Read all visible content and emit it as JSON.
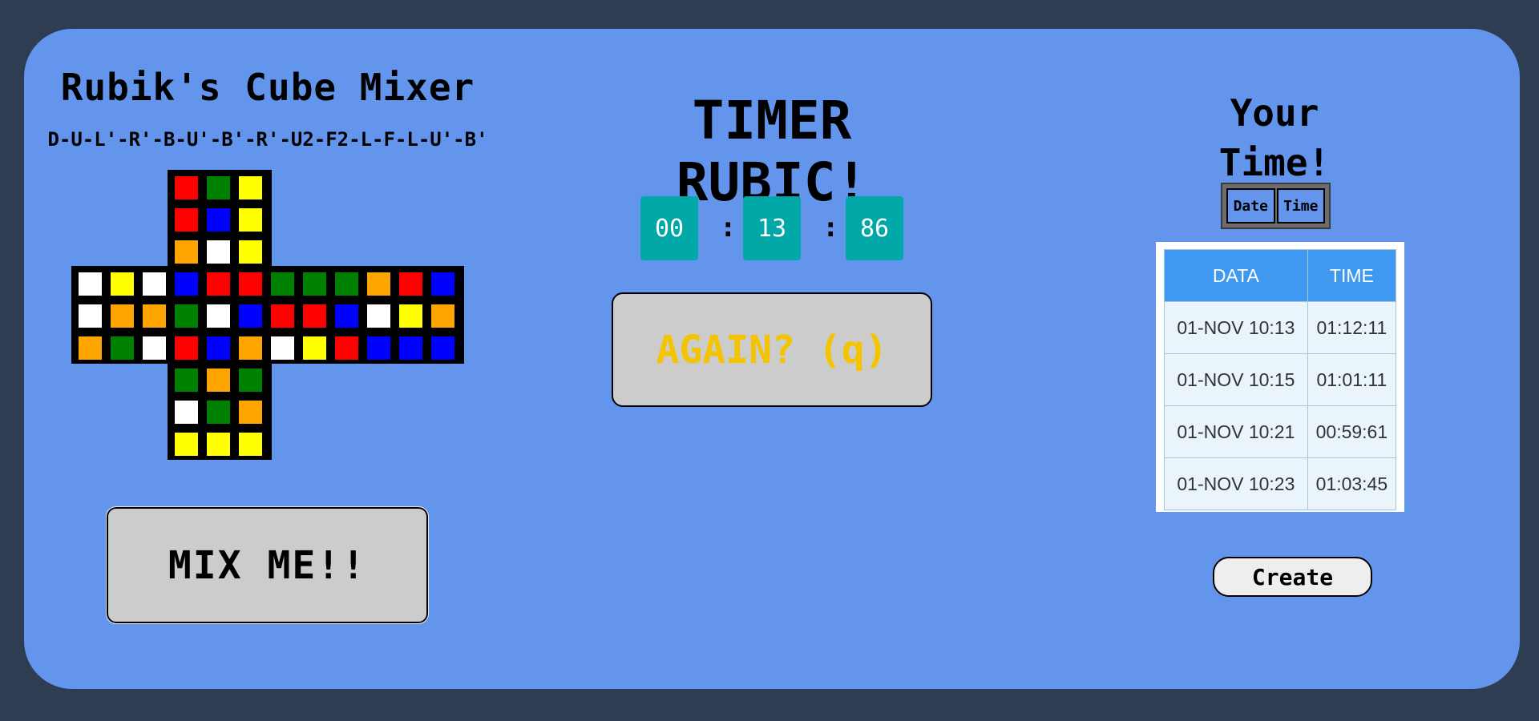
{
  "mixer": {
    "title": "Rubik's Cube Mixer",
    "scramble": "D-U-L'-R'-B-U'-B'-R'-U2-F2-L-F-L-U'-B'",
    "mix_button": "MIX ME!!"
  },
  "cube": {
    "colors": {
      "R": "#ff0000",
      "G": "#008000",
      "B": "#0000ff",
      "Y": "#ffff00",
      "O": "#ffa500",
      "W": "#ffffff"
    },
    "faces": {
      "up": [
        "R",
        "G",
        "Y",
        "R",
        "B",
        "Y",
        "O",
        "W",
        "Y"
      ],
      "left": [
        "W",
        "Y",
        "W",
        "W",
        "O",
        "O",
        "O",
        "G",
        "W"
      ],
      "front": [
        "B",
        "R",
        "R",
        "G",
        "W",
        "B",
        "R",
        "B",
        "O"
      ],
      "right": [
        "G",
        "G",
        "G",
        "R",
        "R",
        "B",
        "W",
        "Y",
        "R"
      ],
      "back": [
        "O",
        "R",
        "B",
        "W",
        "Y",
        "O",
        "B",
        "B",
        "B"
      ],
      "down": [
        "G",
        "O",
        "G",
        "W",
        "G",
        "O",
        "Y",
        "Y",
        "Y"
      ]
    }
  },
  "timer": {
    "title": "TIMER RUBIC!",
    "minutes": "00",
    "seconds": "13",
    "hundredths": "86",
    "separator": ":",
    "again_button": "AGAIN? (q)"
  },
  "history": {
    "heading_line1": "Your",
    "heading_line2": "Time!",
    "sort_date": "Date",
    "sort_time": "Time",
    "columns": [
      "DATA",
      "TIME"
    ],
    "rows": [
      [
        "01-NOV 10:13",
        "01:12:11"
      ],
      [
        "01-NOV 10:15",
        "01:01:11"
      ],
      [
        "01-NOV 10:21",
        "00:59:61"
      ],
      [
        "01-NOV 10:23",
        "01:03:45"
      ]
    ],
    "create_button": "Create"
  }
}
